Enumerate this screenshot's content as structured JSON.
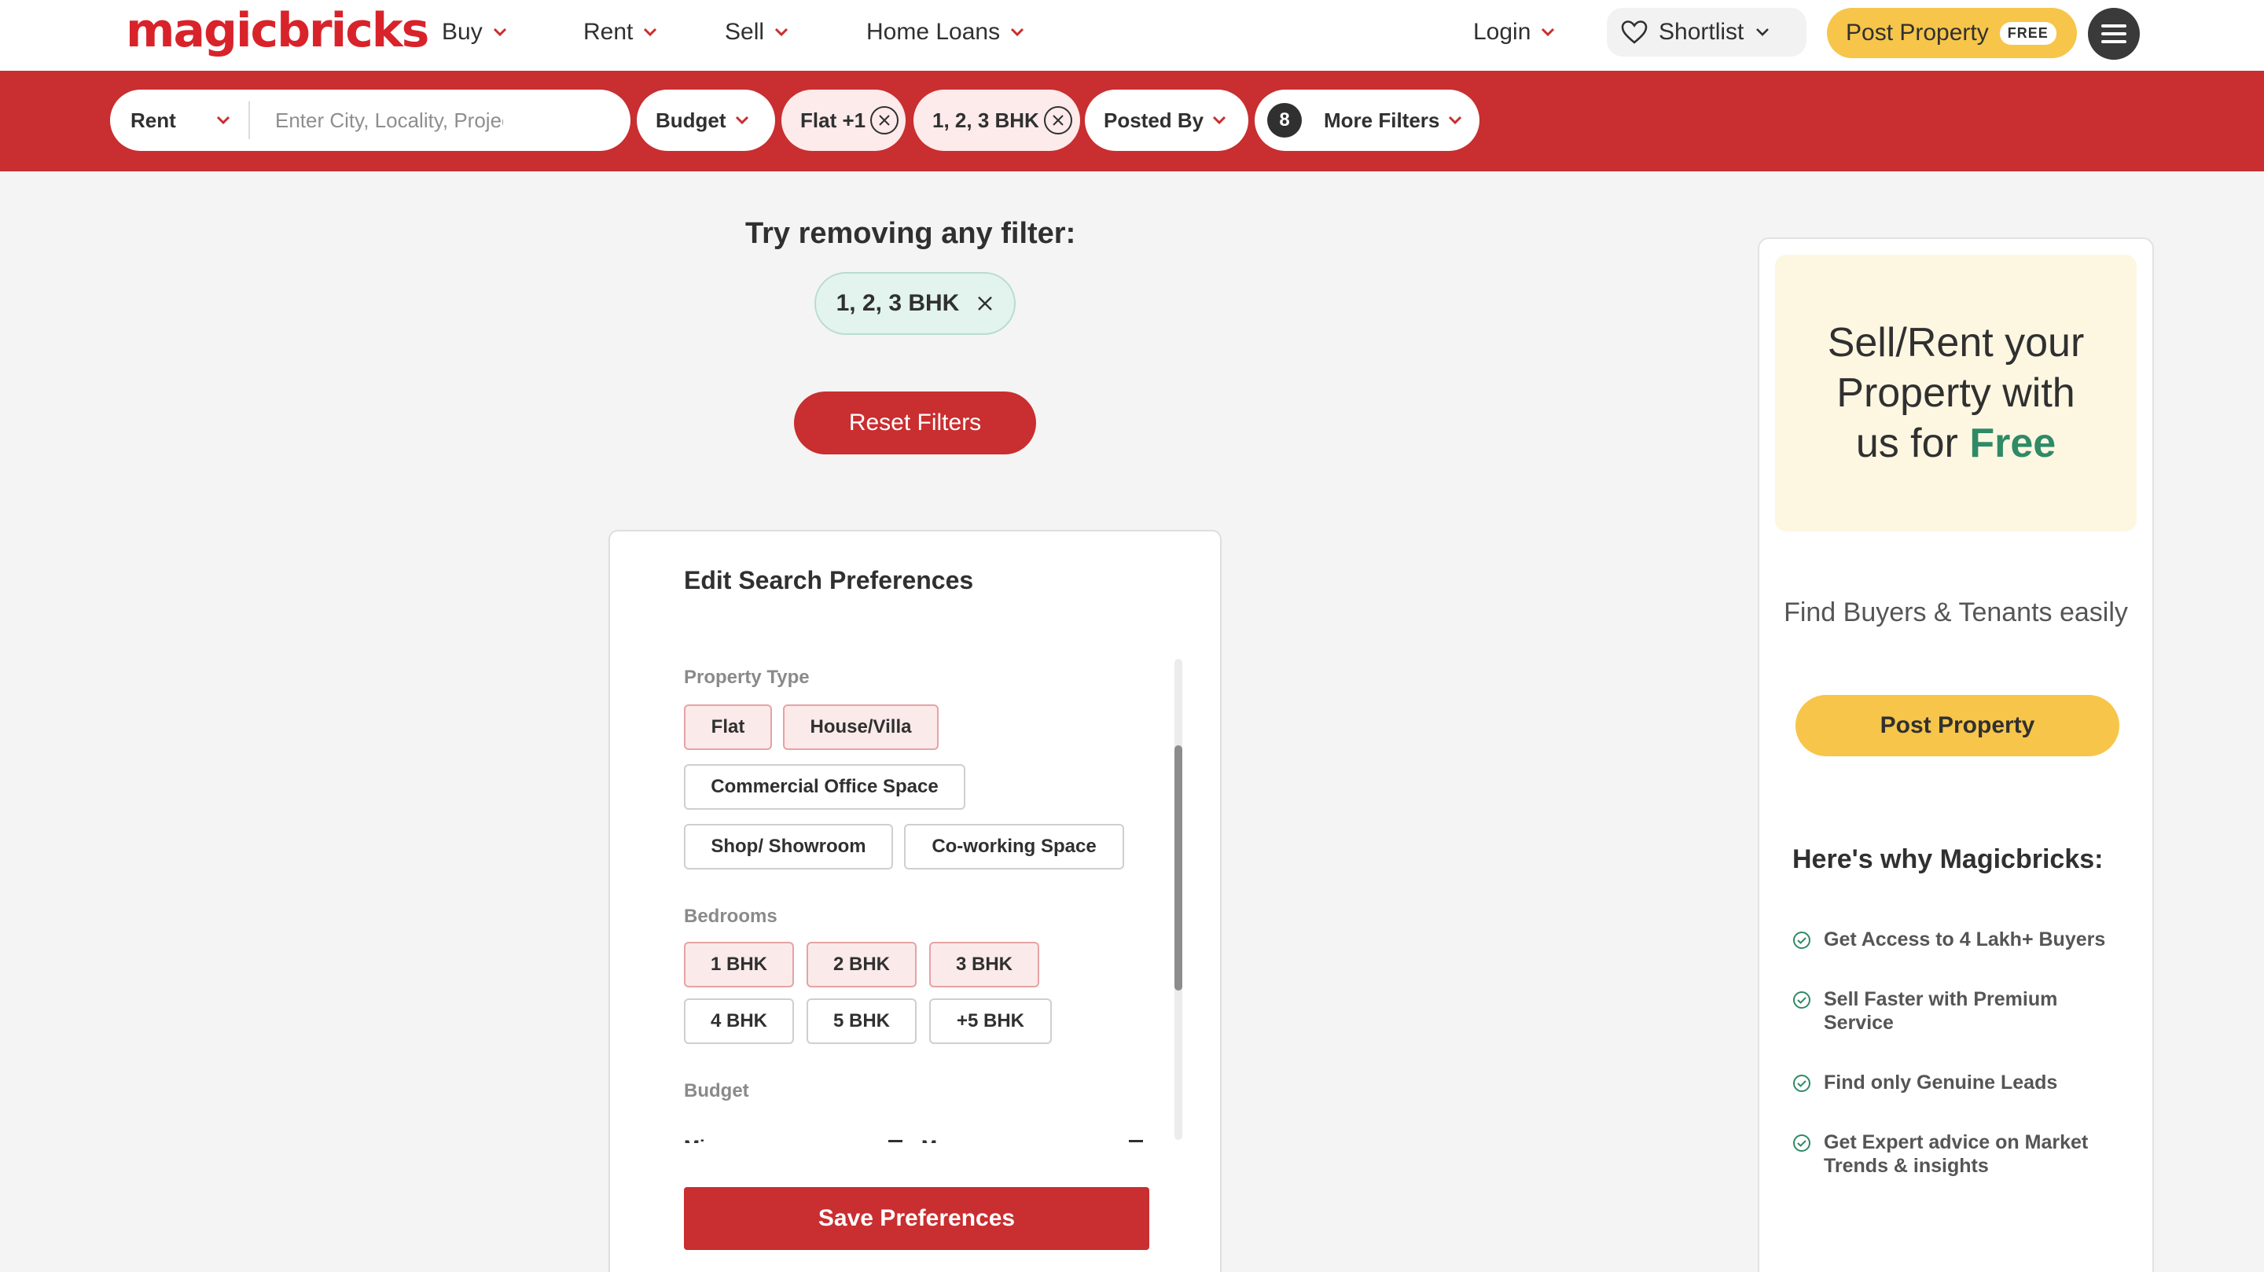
{
  "brand": {
    "logo_text": "magicbricks",
    "accent": "#c92e30",
    "yellow": "#f6c54a"
  },
  "nav": {
    "buy": "Buy",
    "rent": "Rent",
    "sell": "Sell",
    "home_loans": "Home Loans",
    "login": "Login",
    "shortlist": "Shortlist",
    "post_property": "Post Property",
    "free_tag": "FREE",
    "menu_icon": "hamburger-icon"
  },
  "filters": {
    "mode": "Rent",
    "search_placeholder": "Enter City, Locality, Project",
    "budget": "Budget",
    "property_type": "Flat +1",
    "bhk": "1, 2, 3 BHK",
    "posted_by": "Posted By",
    "more_filters_count": "8",
    "more_filters": "More Filters"
  },
  "empty_state": {
    "try_text": "Try removing any filter:",
    "chip": "1, 2, 3 BHK",
    "reset": "Reset Filters"
  },
  "preferences": {
    "title": "Edit Search Preferences",
    "property_type_label": "Property Type",
    "property_types": [
      "Flat",
      "House/Villa",
      "Commercial Office Space",
      "Shop/ Showroom",
      "Co-working Space"
    ],
    "bedrooms_label": "Bedrooms",
    "bedrooms": [
      "1 BHK",
      "2 BHK",
      "3 BHK",
      "4 BHK",
      "5 BHK",
      "+5 BHK"
    ],
    "budget_label": "Budget",
    "min": "Min",
    "max": "Max",
    "save": "Save Preferences"
  },
  "sidebar": {
    "promo_line1": "Sell/Rent your",
    "promo_line2": "Property with",
    "promo_line3": "us for",
    "promo_free": "Free",
    "find_text": "Find Buyers & Tenants easily",
    "post_button": "Post Property",
    "why_title": "Here's why Magicbricks:",
    "why_items": [
      "Get Access to 4 Lakh+ Buyers",
      "Sell Faster with Premium Service",
      "Find only Genuine Leads",
      "Get Expert advice on Market Trends & insights"
    ]
  }
}
